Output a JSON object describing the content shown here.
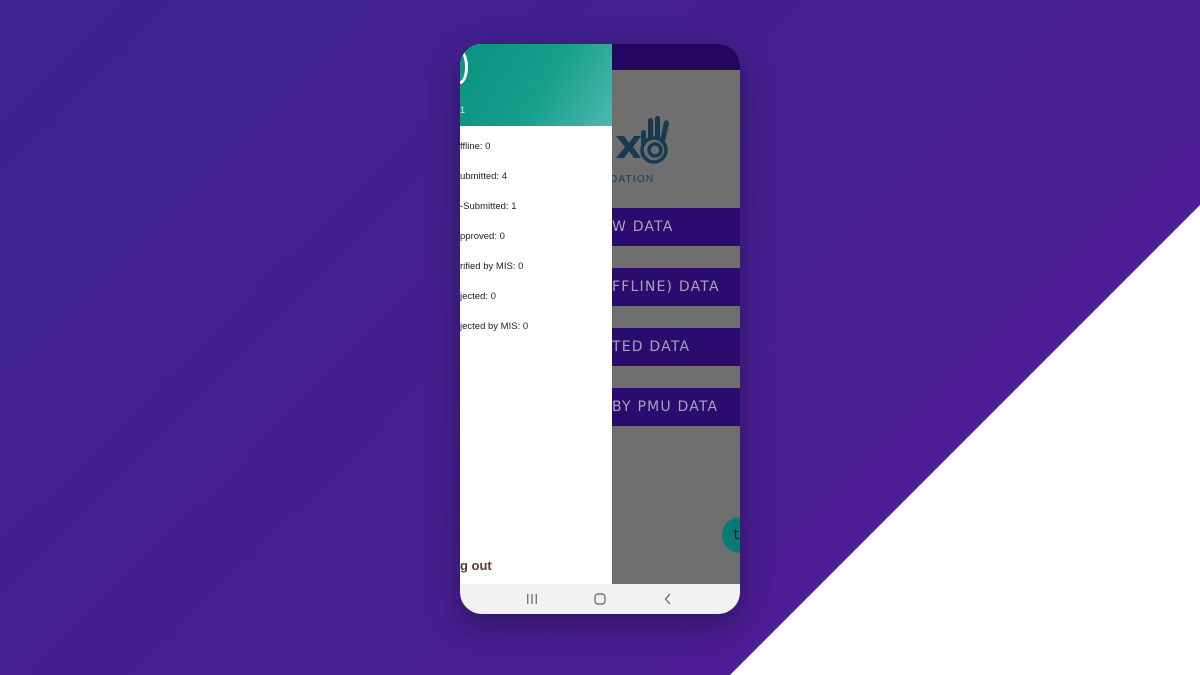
{
  "app": {
    "logo_text": "DATION",
    "buttons": [
      {
        "label": "W DATA"
      },
      {
        "label": "FFLINE) DATA"
      },
      {
        "label": "TED DATA"
      },
      {
        "label": "BY PMU DATA"
      }
    ],
    "fab_label": "t"
  },
  "drawer": {
    "header_subtext": "1",
    "items": [
      {
        "label": "ffline: 0"
      },
      {
        "label": "ubmitted: 4"
      },
      {
        "label": "-Submitted: 1"
      },
      {
        "label": "pproved: 0"
      },
      {
        "label": "rified by MIS: 0"
      },
      {
        "label": "jected: 0"
      },
      {
        "label": "jected by MIS: 0"
      }
    ],
    "logout_label": "g out"
  },
  "colors": {
    "background_start": "#3d2490",
    "background_end": "#521a98",
    "drawer_header_start": "#08927f",
    "drawer_header_end": "#4db8ae",
    "app_button": "#2a0b6e",
    "app_topbar": "#23075e",
    "scrim": "#6f6f6f"
  },
  "icons": [
    "hand-logo-icon",
    "recents-icon",
    "home-icon",
    "back-icon"
  ]
}
